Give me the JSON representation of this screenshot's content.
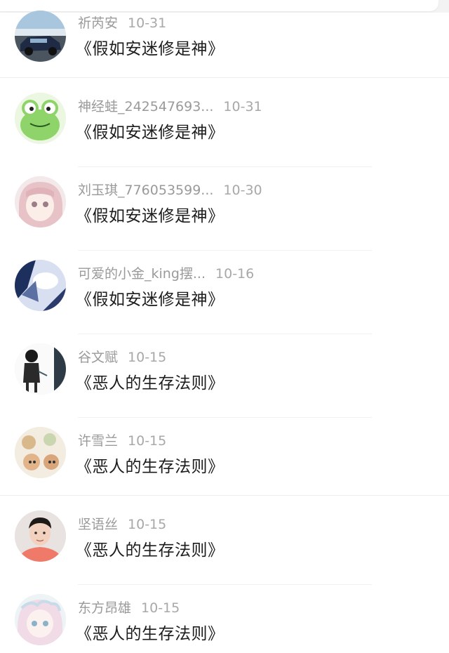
{
  "comments": [
    {
      "user": "祈芮安",
      "date": "10-31",
      "text": "《假如安迷修是神》",
      "avatar_icon": "car-photo-avatar"
    },
    {
      "user": "神经蛙_242547693...",
      "date": "10-31",
      "text": "《假如安迷修是神》",
      "avatar_icon": "green-frog-avatar"
    },
    {
      "user": "刘玉琪_776053599...",
      "date": "10-30",
      "text": "《假如安迷修是神》",
      "avatar_icon": "anime-girl-avatar"
    },
    {
      "user": "可爱的小金_king摆...",
      "date": "10-16",
      "text": "《假如安迷修是神》",
      "avatar_icon": "blue-sky-avatar"
    },
    {
      "user": "谷文赋",
      "date": "10-15",
      "text": "《恶人的生存法则》",
      "avatar_icon": "sketch-figure-avatar"
    },
    {
      "user": "许雪兰",
      "date": "10-15",
      "text": "《恶人的生存法则》",
      "avatar_icon": "cartoon-animals-avatar"
    },
    {
      "user": "坚语丝",
      "date": "10-15",
      "text": "《恶人的生存法则》",
      "avatar_icon": "man-portrait-avatar"
    },
    {
      "user": "东方昂雄",
      "date": "10-15",
      "text": "《恶人的生存法则》",
      "avatar_icon": "pastel-girl-avatar"
    }
  ],
  "colors": {
    "username": "#9a9a9a",
    "date": "#a8a8a8",
    "comment_text": "#1c1c1c",
    "background": "#ffffff"
  }
}
